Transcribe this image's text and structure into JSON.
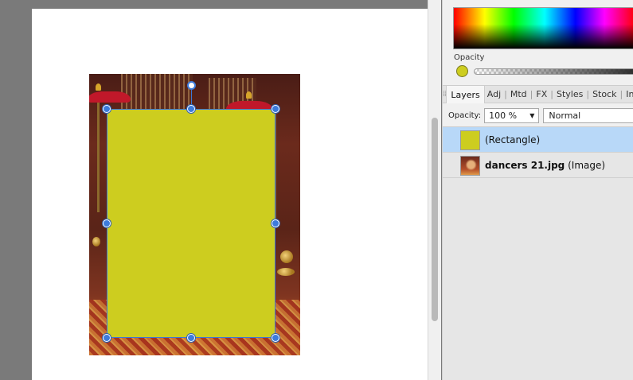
{
  "colors": {
    "rectangle_fill": "#cdcd1f",
    "selection_handle": "#3d7bdb",
    "selected_layer_bg": "#b8d8f8"
  },
  "color_panel": {
    "opacity_label": "Opacity"
  },
  "tabs": [
    {
      "label": "Layers",
      "active": true
    },
    {
      "label": "Adj"
    },
    {
      "label": "Mtd"
    },
    {
      "label": "FX"
    },
    {
      "label": "Styles"
    },
    {
      "label": "Stock"
    },
    {
      "label": "Info"
    }
  ],
  "tab_separator": "|",
  "layers_options": {
    "opacity_label": "Opacity:",
    "opacity_value": "100 %",
    "blend_mode": "Normal"
  },
  "layers": [
    {
      "name": "(Rectangle)",
      "selected": true
    },
    {
      "name_bold": "dancers 21.jpg",
      "type": "(Image)"
    }
  ],
  "icons": {
    "grip": "grip-icon",
    "dropdown": "chevron-down-icon"
  }
}
